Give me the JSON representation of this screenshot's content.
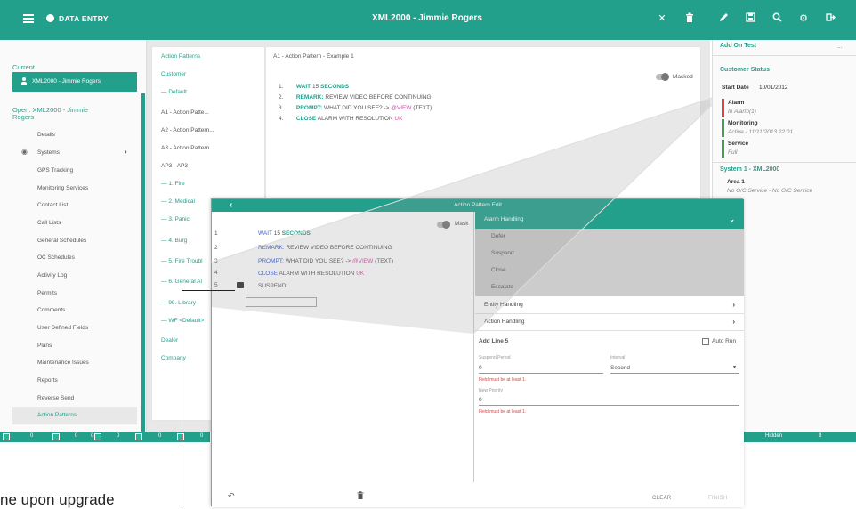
{
  "topbar": {
    "app_label": "DATA ENTRY",
    "window_title": "XML2000 - Jimmie Rogers",
    "icons": [
      "close-icon",
      "trash-icon",
      "pen-icon",
      "save-icon",
      "search-icon",
      "gears-icon",
      "logout-icon"
    ]
  },
  "leftnav": {
    "current_heading": "Current",
    "current_item": "XML2000 - Jimmie Rogers",
    "open_heading": "Open: XML2000 - Jimmie Rogers",
    "items": [
      "Details",
      "Systems",
      "GPS Tracking",
      "Monitoring Services",
      "Contact List",
      "Call Lists",
      "General Schedules",
      "OC Schedules",
      "Activity Log",
      "Permits",
      "Comments",
      "User Defined Fields",
      "Plans",
      "Maintenance Issues",
      "Reports",
      "Reverse Send",
      "Action Patterns"
    ]
  },
  "status_bar": {
    "values": [
      "0",
      "0",
      "0",
      "0",
      "0",
      "0",
      "0"
    ]
  },
  "action_patterns": {
    "heading": "Action Patterns",
    "customer": "Customer",
    "default": "Default",
    "items": [
      "A1 - Action Patte...",
      "A2 - Action Pattern...",
      "A3 - Action Pattern...",
      "AP3 - AP3",
      "1. Fire",
      "2. Medical",
      "3. Panic",
      "4. Burg",
      "5. Fire Troubl",
      "6. General Al",
      "99. Library",
      "WF <Default>"
    ],
    "dealer": "Dealer",
    "company": "Company"
  },
  "main": {
    "title": "A1 - Action Pattern - Example 1",
    "masked_label": "Masked",
    "lines": [
      {
        "num": "1.",
        "kw": "WAIT",
        "rest": "15",
        "kw2": "SECONDS",
        "tail": ""
      },
      {
        "num": "2.",
        "kw": "REMARK:",
        "rest": "REVIEW VIDEO BEFORE CONTINUING",
        "kw2": "",
        "tail": ""
      },
      {
        "num": "3.",
        "kw": "PROMPT:",
        "rest": "WHAT DID YOU SEE? ->",
        "kw2": "@VIEW",
        "tail": "(TEXT)"
      },
      {
        "num": "4.",
        "kw": "CLOSE",
        "rest": "ALARM WITH RESOLUTION",
        "kw2": "UK",
        "tail": ""
      }
    ]
  },
  "right": {
    "add_on_test": "Add On Test",
    "more": "...",
    "customer_status": "Customer Status",
    "start_date_label": "Start Date",
    "start_date": "10/01/2012",
    "alarm": "Alarm",
    "alarm_sub": "In Alarm(1)",
    "monitoring": "Monitoring",
    "monitoring_sub": "Active - 11/11/2013 22:01",
    "service": "Service",
    "service_sub": "Full",
    "system_heading": "System 1 - XML2000",
    "area": "Area 1",
    "area_sub": "No O/C Service - No O/C Service",
    "hidden_label": "Hidden",
    "hidden_count": "8"
  },
  "dialog": {
    "title": "Action Pattern Edit",
    "mask_label": "Mask",
    "line_nums": [
      "1",
      "2",
      "3",
      "4",
      "5"
    ],
    "lines": [
      {
        "kw": "WAIT",
        "rest": "15",
        "kw2": "SECONDS",
        "tail": ""
      },
      {
        "kw": "REMARK:",
        "rest": "REVIEW VIDEO BEFORE CONTINUING",
        "kw2": "",
        "tail": ""
      },
      {
        "kw": "PROMPT:",
        "rest": "WHAT DID YOU SEE? ->",
        "kw2": "@VIEW",
        "tail": "(TEXT)"
      },
      {
        "kw": "CLOSE",
        "rest": "ALARM WITH RESOLUTION",
        "kw2": "UK",
        "tail": ""
      }
    ],
    "suspend_line": "SUSPEND",
    "alarm_handling": "Alarm Handling",
    "alarm_options": [
      "Defer",
      "Suspend",
      "Close",
      "Escalate"
    ],
    "entity_handling": "Entity Handling",
    "action_handling": "Action Handling",
    "add_line": "Add Line 5",
    "auto_run": "Auto Run",
    "suspend_period_label": "Suspend Period",
    "suspend_period_value": "0",
    "interval_label": "Interval",
    "interval_value": "Second",
    "err1": "Field must be at least 1.",
    "new_priority_label": "New Priority",
    "new_priority_value": "0",
    "err2": "Field must be at least 1.",
    "clear": "CLEAR",
    "finish": "FINISH"
  },
  "callout": {
    "text": "ne upon upgrade"
  }
}
